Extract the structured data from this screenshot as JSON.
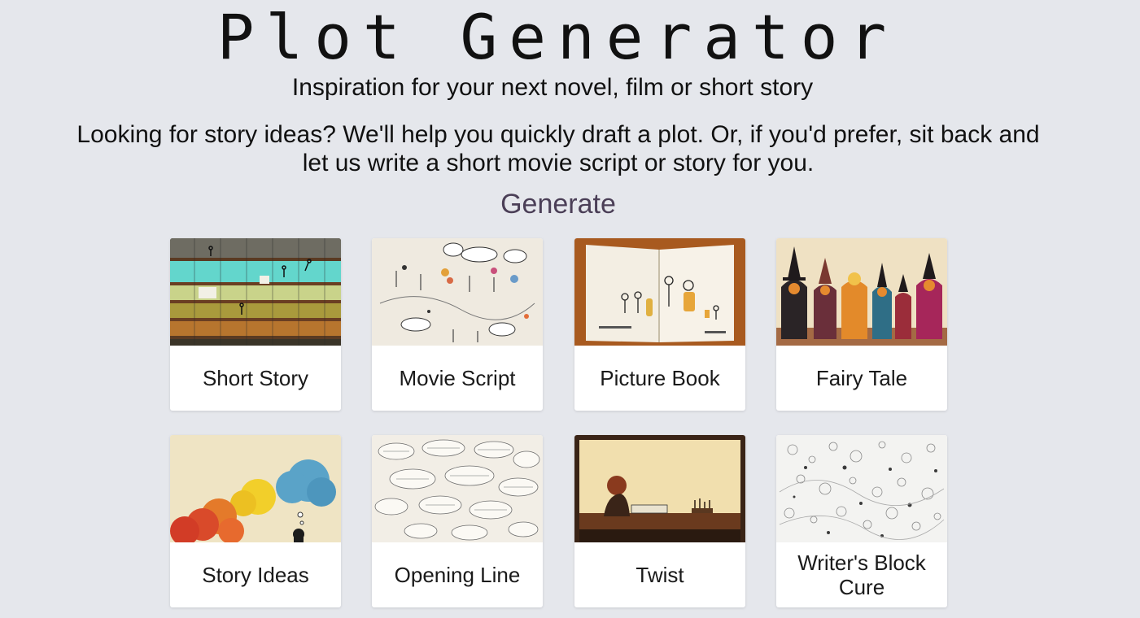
{
  "header": {
    "title": "Plot Generator",
    "subtitle": "Inspiration for your next novel, film or short story",
    "intro": "Looking for story ideas? We'll help you quickly draft a plot. Or, if you'd prefer, sit back and let us write a short movie script or story for you."
  },
  "generate": {
    "heading": "Generate",
    "cards": [
      {
        "label": "Short Story"
      },
      {
        "label": "Movie Script"
      },
      {
        "label": "Picture Book"
      },
      {
        "label": "Fairy Tale"
      },
      {
        "label": "Story Ideas"
      },
      {
        "label": "Opening Line"
      },
      {
        "label": "Twist"
      },
      {
        "label": "Writer's Block Cure"
      }
    ]
  },
  "colors": {
    "background": "#e5e7ec",
    "heading_accent": "#4b3f57",
    "card_background": "#ffffff"
  }
}
